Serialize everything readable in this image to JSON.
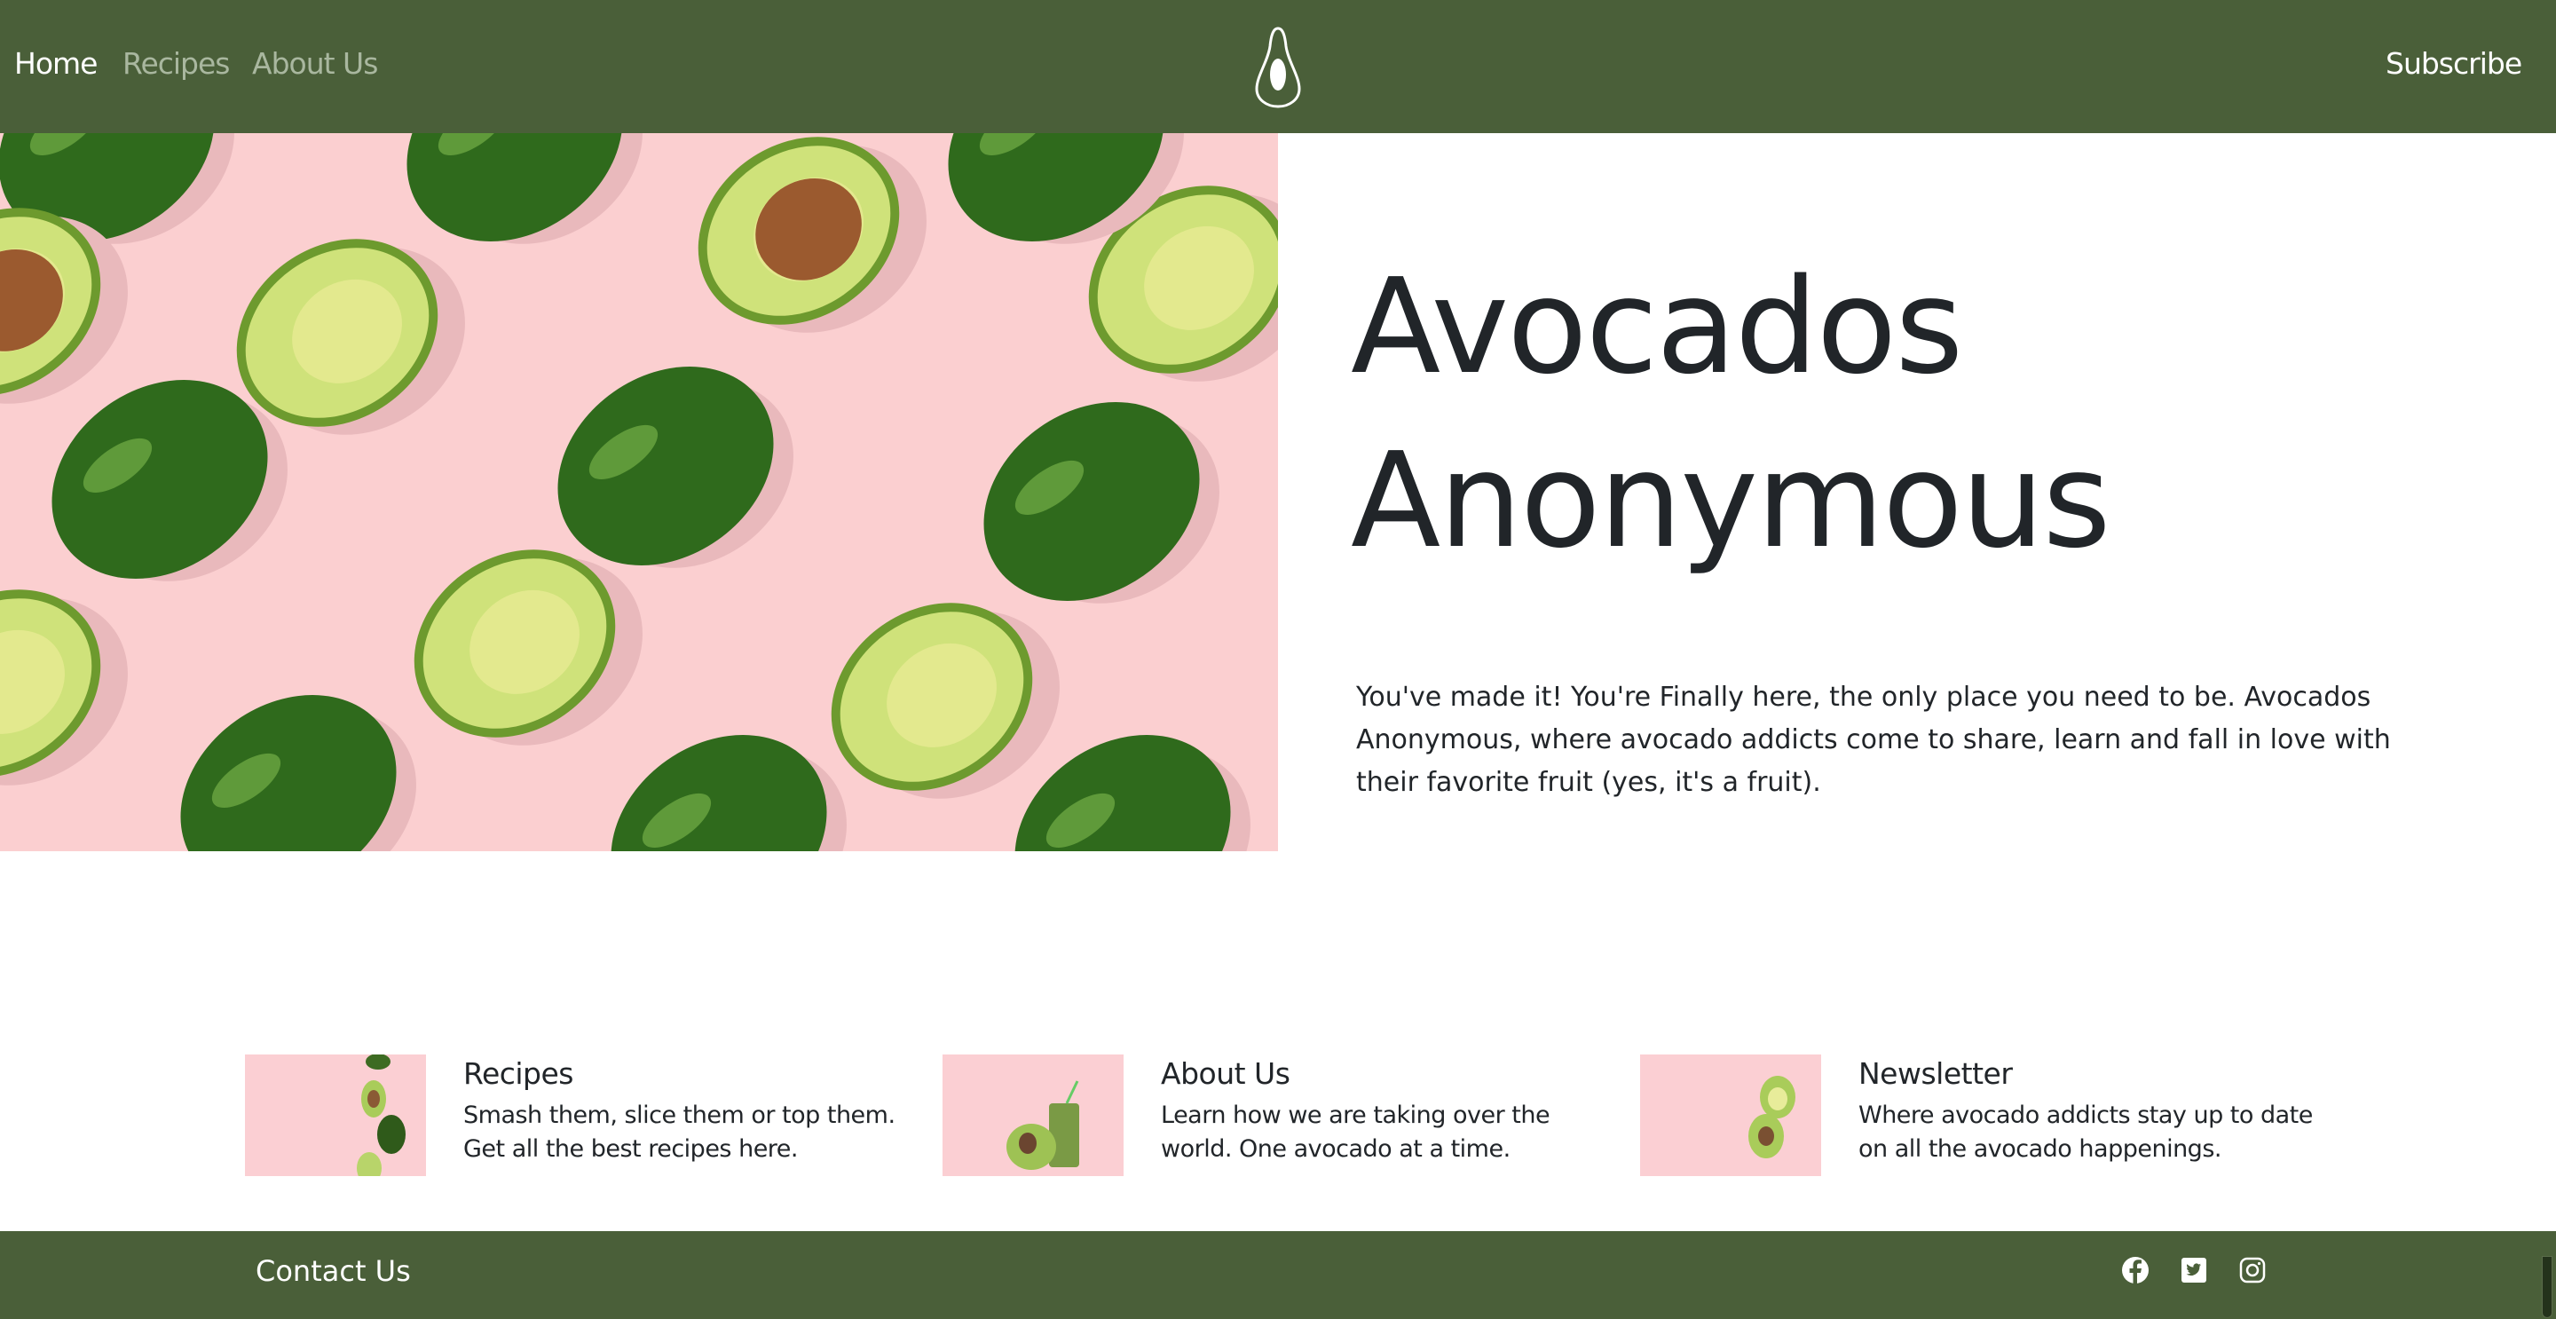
{
  "nav": {
    "items": [
      {
        "label": "Home",
        "active": true
      },
      {
        "label": "Recipes",
        "active": false
      },
      {
        "label": "About Us",
        "active": false
      }
    ],
    "subscribe": "Subscribe",
    "logo": "avocado-logo-icon"
  },
  "hero": {
    "title_line1": "Avocados",
    "title_line2": "Anonymous",
    "lead": "You've made it! You're Finally here, the only place you need to be. Avocados Anonymous, where avocado addicts come to share, learn and fall in love with their favorite fruit (yes, it's a fruit)."
  },
  "cards": [
    {
      "title": "Recipes",
      "text": "Smash them, slice them or top them. Get all the best recipes here."
    },
    {
      "title": "About Us",
      "text": "Learn how we are taking over the world. One avocado at a time."
    },
    {
      "title": "Newsletter",
      "text": "Where avocado addicts stay up to date on all the avocado happenings."
    }
  ],
  "footer": {
    "contact": "Contact Us",
    "social": [
      "facebook-icon",
      "twitter-icon",
      "instagram-icon"
    ]
  },
  "colors": {
    "brand": "#4a5f39",
    "pink": "#fbcfd0",
    "text": "#212529"
  }
}
